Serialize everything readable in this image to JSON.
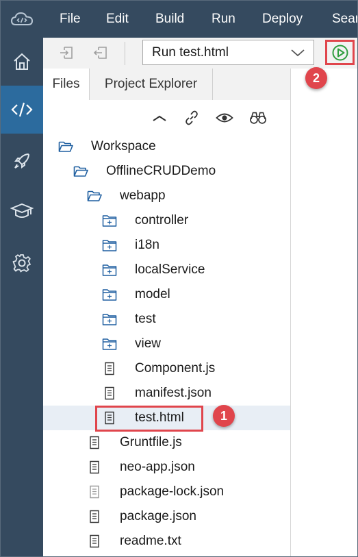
{
  "menu": {
    "items": [
      "File",
      "Edit",
      "Build",
      "Run",
      "Deploy",
      "Sear"
    ]
  },
  "rail": {
    "icons": [
      "home-icon",
      "code-icon",
      "rocket-icon",
      "graduation-cap-icon",
      "gear-icon"
    ],
    "active": "code-icon"
  },
  "toolbar": {
    "run_config": "Run test.html",
    "run_button_icon": "play-circle-icon"
  },
  "tabs": [
    "Files",
    "Project Explorer"
  ],
  "tree_actions": [
    "collapse-all-icon",
    "link-icon",
    "eye-icon",
    "binoculars-icon"
  ],
  "tree": {
    "workspace": "Workspace",
    "project": "OfflineCRUDDemo",
    "webapp": "webapp",
    "webapp_children": [
      "controller",
      "i18n",
      "localService",
      "model",
      "test",
      "view",
      "Component.js",
      "manifest.json",
      "test.html"
    ],
    "project_files": [
      "Gruntfile.js",
      "neo-app.json",
      "package-lock.json",
      "package.json",
      "readme.txt"
    ],
    "selected": "test.html"
  },
  "callouts": [
    "1",
    "2"
  ],
  "colors": {
    "menubar": "#354a5f",
    "rail_active": "#2c6b9e",
    "callout": "#e0454c",
    "run_icon": "#2e9e3e",
    "selected_row": "#e8eef5"
  }
}
